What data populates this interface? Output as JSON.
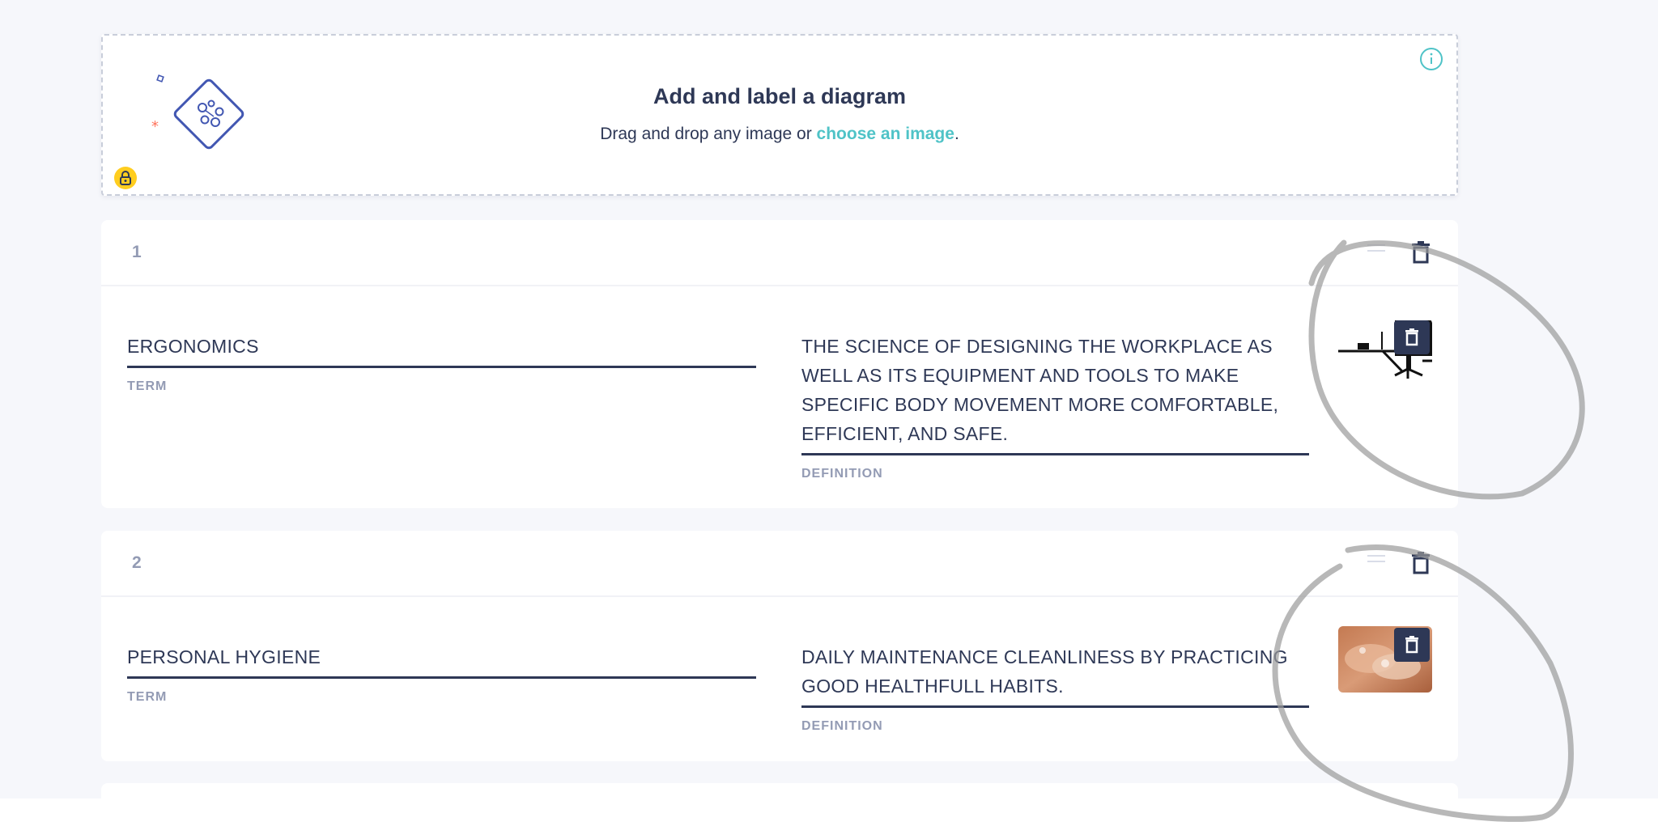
{
  "diagram": {
    "title": "Add and label a diagram",
    "subtitle_prefix": "Drag and drop any image or ",
    "subtitle_link": "choose an image",
    "subtitle_suffix": "."
  },
  "cards": [
    {
      "number": "1",
      "term": "ERGONOMICS",
      "term_label": "TERM",
      "definition": "THE SCIENCE OF DESIGNING THE WORKPLACE AS WELL AS ITS EQUIPMENT AND TOOLS TO MAKE SPECIFIC BODY MOVEMENT MORE COMFORTABLE, EFFICIENT, AND SAFE.",
      "definition_label": "DEFINITION",
      "image": "office-desk-chair-image"
    },
    {
      "number": "2",
      "term": "PERSONAL HYGIENE",
      "term_label": "TERM",
      "definition": "DAILY MAINTENANCE CLEANLINESS BY PRACTICING GOOD HEALTHFULL HABITS.",
      "definition_label": "DEFINITION",
      "image": "hand-washing-image"
    }
  ],
  "colors": {
    "text": "#2e3856",
    "muted": "#939bb4",
    "link": "#4fc3c7",
    "lock": "#ffcd1f",
    "background": "#f6f7fb"
  }
}
